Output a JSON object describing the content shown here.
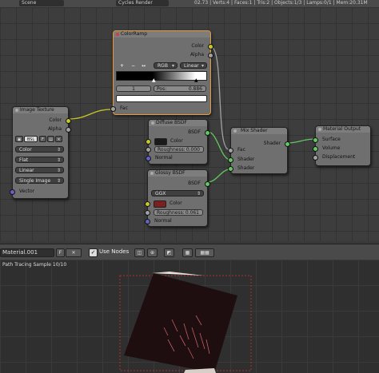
{
  "topbar": {
    "scene_label": "Scene",
    "engine_label": "Cycles Render",
    "stats": "02.73 | Verts:4 | Faces:1 | Tris:2 | Objects:1/3 | Lamps:0/1 | Mem:20.31M"
  },
  "nodes": {
    "colorramp": {
      "title": "ColorRamp",
      "out_color": "Color",
      "out_alpha": "Alpha",
      "tool_add": "+",
      "tool_remove": "−",
      "tool_flip": "↔",
      "color_mode": "RGB",
      "interpolation": "Linear",
      "index": "1",
      "pos_label": "Pos:",
      "pos_value": "0.886",
      "in_fac": "Fac"
    },
    "image_texture": {
      "title": "Image Texture",
      "out_color": "Color",
      "out_alpha": "Alpha",
      "image_name": "BSL",
      "image_users": "F",
      "color_space": "Color",
      "projection": "Flat",
      "interpolation": "Linear",
      "source": "Single Image",
      "in_vector": "Vector"
    },
    "diffuse": {
      "title": "Diffuse BSDF",
      "out_bsdf": "BSDF",
      "in_color": "Color",
      "roughness_label": "Roughness:",
      "roughness_value": "0.000",
      "in_normal": "Normal",
      "color_hex": "#1a1a1a"
    },
    "glossy": {
      "title": "Glossy BSDF",
      "out_bsdf": "BSDF",
      "distribution": "GGX",
      "in_color": "Color",
      "roughness_label": "Roughness:",
      "roughness_value": "0.061",
      "in_normal": "Normal",
      "color_hex": "#7a2020"
    },
    "mix": {
      "title": "Mix Shader",
      "out_shader": "Shader",
      "in_fac": "Fac",
      "in_shader1": "Shader",
      "in_shader2": "Shader"
    },
    "output": {
      "title": "Material Output",
      "in_surface": "Surface",
      "in_volume": "Volume",
      "in_displacement": "Displacement"
    }
  },
  "node_header": {
    "material_name": "Material.001",
    "fake_user": "F",
    "use_nodes_label": "Use Nodes"
  },
  "viewport": {
    "status": "Path Tracing Sample 10/10"
  },
  "colors": {
    "node_selected_border": "#e69a35",
    "socket_color": "#c7c729",
    "socket_shader": "#63c763",
    "socket_vector": "#6363c7",
    "socket_gray": "#a1a1a1",
    "crop_border": "#d03030"
  }
}
